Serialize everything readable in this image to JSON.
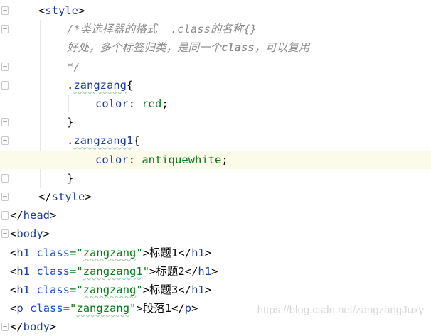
{
  "editor": {
    "highlighted_line": 8,
    "lines": [
      {
        "indent": 1,
        "fold": true,
        "tokens": [
          {
            "t": "<",
            "c": "br"
          },
          {
            "t": "style",
            "c": "tag"
          },
          {
            "t": ">",
            "c": "br"
          }
        ]
      },
      {
        "indent": 2,
        "fold": true,
        "tokens": [
          {
            "t": "/*类选择器的格式  .class的名称{}",
            "c": "cm"
          }
        ]
      },
      {
        "indent": 2,
        "fold": false,
        "tokens": [
          {
            "t": "好处，多个标签归类，是同一个",
            "c": "cm"
          },
          {
            "t": "class",
            "c": "cmb"
          },
          {
            "t": "，可以复用",
            "c": "cm"
          }
        ]
      },
      {
        "indent": 2,
        "fold": true,
        "tokens": [
          {
            "t": "*/",
            "c": "cm"
          }
        ]
      },
      {
        "indent": 2,
        "fold": true,
        "tokens": [
          {
            "t": ".",
            "c": "br"
          },
          {
            "t": "zangzang",
            "c": "sel",
            "w": 1
          },
          {
            "t": "{",
            "c": "br"
          }
        ]
      },
      {
        "indent": 3,
        "fold": false,
        "tokens": [
          {
            "t": "color",
            "c": "prop"
          },
          {
            "t": ": ",
            "c": "br"
          },
          {
            "t": "red",
            "c": "val"
          },
          {
            "t": ";",
            "c": "br"
          }
        ]
      },
      {
        "indent": 2,
        "fold": true,
        "tokens": [
          {
            "t": "}",
            "c": "br"
          }
        ]
      },
      {
        "indent": 2,
        "fold": true,
        "tokens": [
          {
            "t": ".",
            "c": "br"
          },
          {
            "t": "zangzang1",
            "c": "sel",
            "w": 1
          },
          {
            "t": "{",
            "c": "br"
          }
        ]
      },
      {
        "indent": 3,
        "fold": false,
        "tokens": [
          {
            "t": "color",
            "c": "prop"
          },
          {
            "t": ": ",
            "c": "br"
          },
          {
            "t": "antiquewhite",
            "c": "val"
          },
          {
            "t": ";",
            "c": "br"
          }
        ]
      },
      {
        "indent": 2,
        "fold": true,
        "tokens": [
          {
            "t": "}",
            "c": "br"
          }
        ]
      },
      {
        "indent": 1,
        "fold": true,
        "tokens": [
          {
            "t": "</",
            "c": "br"
          },
          {
            "t": "style",
            "c": "tag"
          },
          {
            "t": ">",
            "c": "br"
          }
        ]
      },
      {
        "indent": 0,
        "fold": true,
        "tokens": [
          {
            "t": "</",
            "c": "br"
          },
          {
            "t": "head",
            "c": "tag"
          },
          {
            "t": ">",
            "c": "br"
          }
        ]
      },
      {
        "indent": 0,
        "fold": true,
        "tokens": [
          {
            "t": "<",
            "c": "br"
          },
          {
            "t": "body",
            "c": "tag"
          },
          {
            "t": ">",
            "c": "br"
          }
        ]
      },
      {
        "indent": 0,
        "fold": false,
        "tokens": [
          {
            "t": "<",
            "c": "br"
          },
          {
            "t": "h1",
            "c": "tag"
          },
          {
            "t": " ",
            "c": "br"
          },
          {
            "t": "class",
            "c": "attr"
          },
          {
            "t": "=\"",
            "c": "str"
          },
          {
            "t": "zangzang",
            "c": "str",
            "w": 1
          },
          {
            "t": "\"",
            "c": "str"
          },
          {
            "t": ">",
            "c": "br"
          },
          {
            "t": "标题1",
            "c": "txt"
          },
          {
            "t": "</",
            "c": "br"
          },
          {
            "t": "h1",
            "c": "tag"
          },
          {
            "t": ">",
            "c": "br"
          }
        ]
      },
      {
        "indent": 0,
        "fold": false,
        "tokens": [
          {
            "t": "<",
            "c": "br"
          },
          {
            "t": "h1",
            "c": "tag"
          },
          {
            "t": " ",
            "c": "br"
          },
          {
            "t": "class",
            "c": "attr"
          },
          {
            "t": "=\"",
            "c": "str"
          },
          {
            "t": "zangzang1",
            "c": "str",
            "w": 1
          },
          {
            "t": "\"",
            "c": "str"
          },
          {
            "t": ">",
            "c": "br"
          },
          {
            "t": "标题2",
            "c": "txt"
          },
          {
            "t": "</",
            "c": "br"
          },
          {
            "t": "h1",
            "c": "tag"
          },
          {
            "t": ">",
            "c": "br"
          }
        ]
      },
      {
        "indent": 0,
        "fold": false,
        "tokens": [
          {
            "t": "<",
            "c": "br"
          },
          {
            "t": "h1",
            "c": "tag"
          },
          {
            "t": " ",
            "c": "br"
          },
          {
            "t": "class",
            "c": "attr"
          },
          {
            "t": "=\"",
            "c": "str"
          },
          {
            "t": "zangzang",
            "c": "str",
            "w": 1
          },
          {
            "t": "\"",
            "c": "str"
          },
          {
            "t": ">",
            "c": "br"
          },
          {
            "t": "标题3",
            "c": "txt"
          },
          {
            "t": "</",
            "c": "br"
          },
          {
            "t": "h1",
            "c": "tag"
          },
          {
            "t": ">",
            "c": "br"
          }
        ]
      },
      {
        "indent": 0,
        "fold": false,
        "tokens": [
          {
            "t": "<",
            "c": "br"
          },
          {
            "t": "p",
            "c": "tag"
          },
          {
            "t": " ",
            "c": "br"
          },
          {
            "t": "class",
            "c": "attr"
          },
          {
            "t": "=\"",
            "c": "str"
          },
          {
            "t": "zangzang",
            "c": "str",
            "w": 1
          },
          {
            "t": "\"",
            "c": "str"
          },
          {
            "t": ">",
            "c": "br"
          },
          {
            "t": "段落1",
            "c": "txt"
          },
          {
            "t": "</",
            "c": "br"
          },
          {
            "t": "p",
            "c": "tag"
          },
          {
            "t": ">",
            "c": "br"
          }
        ]
      },
      {
        "indent": 0,
        "fold": true,
        "tokens": [
          {
            "t": "</",
            "c": "br"
          },
          {
            "t": "body",
            "c": "tag"
          },
          {
            "t": ">",
            "c": "br"
          }
        ]
      }
    ]
  },
  "watermark": "https://blog.csdn.net/zangzangJuxy"
}
